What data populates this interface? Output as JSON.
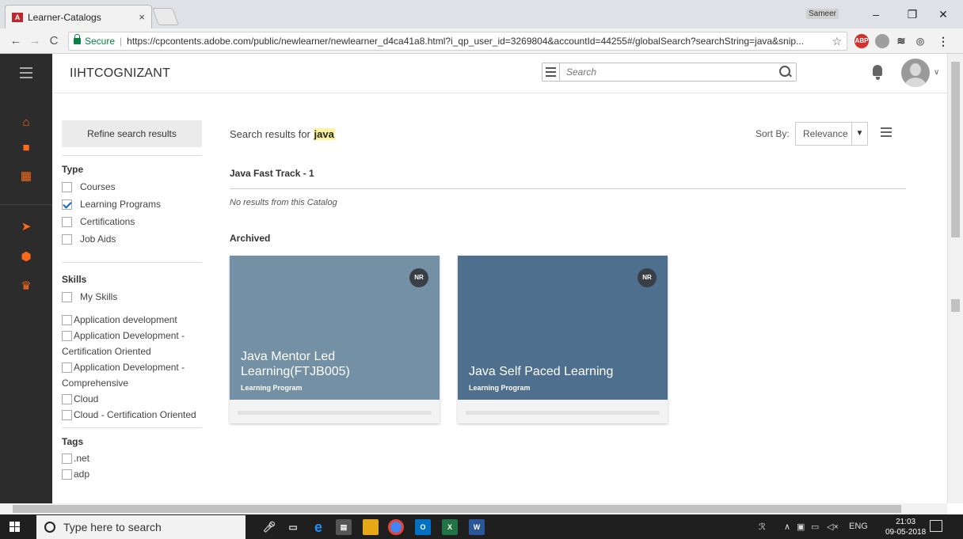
{
  "browser": {
    "tab_title": "Learner-Catalogs",
    "tab_close": "×",
    "user": "Sameer",
    "controls": [
      "–",
      "❐",
      "✕"
    ],
    "secure_label": "Secure",
    "url": "https://cpcontents.adobe.com/public/newlearner/newlearner_d4ca41a8.html?i_qp_user_id=3269804&accountId=44255#/globalSearch?searchString=java&snip...",
    "nav": [
      "←",
      "→",
      "C"
    ],
    "menu": "⋮"
  },
  "app": {
    "brand": "IIHTCOGNIZANT",
    "search_placeholder": "Search"
  },
  "filters": {
    "refine_label": "Refine search results",
    "type_heading": "Type",
    "types": [
      {
        "label": "Courses",
        "checked": false
      },
      {
        "label": "Learning Programs",
        "checked": true
      },
      {
        "label": "Certifications",
        "checked": false
      },
      {
        "label": "Job Aids",
        "checked": false
      }
    ],
    "skills_heading": "Skills",
    "my_skills": "My Skills",
    "skills": [
      "Application development",
      "Application Development - Certification Oriented",
      "Application Development - Comprehensive",
      "Cloud",
      "Cloud - Certification Oriented"
    ],
    "tags_heading": "Tags",
    "tags": [
      ".net",
      "adp"
    ]
  },
  "results": {
    "label_prefix": "Search results for ",
    "term": "java",
    "sort_label": "Sort By:",
    "sort_value": "Relevance",
    "catalog_title": "Java Fast Track - 1",
    "catalog_empty": "No results from this Catalog",
    "archived_heading": "Archived",
    "cards": [
      {
        "title": "Java Mentor Led Learning(FTJB005)",
        "type": "Learning Program",
        "badge": "NR",
        "color": "#7390a5"
      },
      {
        "title": "Java Self Paced Learning",
        "type": "Learning Program",
        "badge": "NR",
        "color": "#4e6f8e"
      }
    ]
  },
  "taskbar": {
    "search_placeholder": "Type here to search",
    "lang": "ENG",
    "time": "21:03",
    "date": "09-05-2018"
  }
}
